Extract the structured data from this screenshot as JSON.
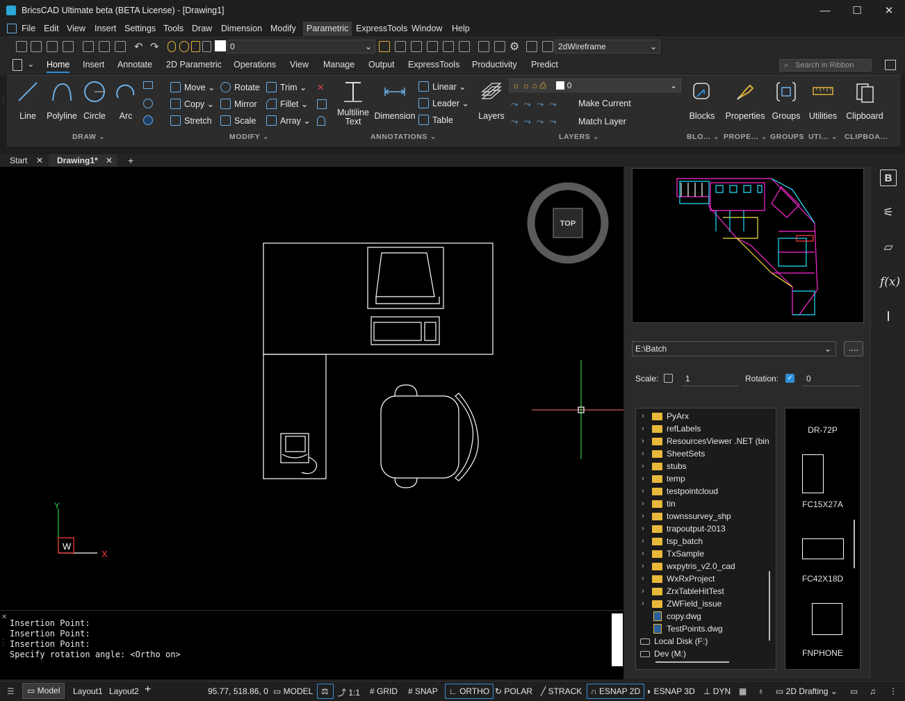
{
  "window": {
    "title": "BricsCAD Ultimate beta (BETA License) - [Drawing1]",
    "controls": [
      "minimize",
      "maximize",
      "close"
    ]
  },
  "menu": [
    "File",
    "Edit",
    "View",
    "Insert",
    "Settings",
    "Tools",
    "Draw",
    "Dimension",
    "Modify",
    "Parametric",
    "ExpressTools",
    "Window",
    "Help"
  ],
  "menu_active": "Parametric",
  "toolbar": {
    "layer_value": "0",
    "visual_style": "2dWireframe"
  },
  "ribbon_tabs": [
    "Home",
    "Insert",
    "Annotate",
    "2D Parametric",
    "Operations",
    "View",
    "Manage",
    "Output",
    "ExpressTools",
    "Productivity",
    "Predict"
  ],
  "ribbon_active": "Home",
  "ribbon_search_placeholder": "Search in Ribbon",
  "ribbon": {
    "draw": {
      "title": "DRAW",
      "line": "Line",
      "polyline": "Polyline",
      "circle": "Circle",
      "arc": "Arc"
    },
    "modify": {
      "title": "MODIFY",
      "move": "Move",
      "rotate": "Rotate",
      "trim": "Trim",
      "copy": "Copy",
      "mirror": "Mirror",
      "fillet": "Fillet",
      "stretch": "Stretch",
      "scale": "Scale",
      "array": "Array"
    },
    "annotations": {
      "title": "ANNOTATIONS",
      "mtext": "Multiline Text",
      "dimension": "Dimension",
      "linear": "Linear",
      "leader": "Leader",
      "table": "Table"
    },
    "layers": {
      "title": "LAYERS",
      "layers_btn": "Layers",
      "layer_value": "0",
      "make_current": "Make Current",
      "match_layer": "Match Layer"
    },
    "blocks": {
      "label": "Blocks",
      "title": "BLO..."
    },
    "properties": {
      "label": "Properties",
      "title": "PROPE..."
    },
    "groups": {
      "label": "Groups",
      "title": "GROUPS"
    },
    "utilities": {
      "label": "Utilities",
      "title": "UTI..."
    },
    "clipboard": {
      "label": "Clipboard",
      "title": "CLIPBOA..."
    }
  },
  "doc_tabs": [
    {
      "label": "Start"
    },
    {
      "label": "Drawing1*"
    }
  ],
  "canvas": {
    "viewcube_label": "TOP",
    "ucs_y": "Y",
    "ucs_x": "X",
    "ucs_w": "W"
  },
  "command_history": [
    "Insertion Point:",
    "Insertion Point:",
    "Insertion Point:",
    "Specify rotation angle: <Ortho on>"
  ],
  "status": {
    "layouts": [
      "Model",
      "Layout1",
      "Layout2"
    ],
    "coords": "95.77, 518.86, 0",
    "model": "MODEL",
    "scale": "1:1",
    "grid": "GRID",
    "snap": "SNAP",
    "ortho": "ORTHO",
    "polar": "POLAR",
    "strack": "STRACK",
    "esnap2d": "ESNAP 2D",
    "esnap3d": "ESNAP 3D",
    "dyn": "DYN",
    "workspace": "2D Drafting"
  },
  "blocks_panel": {
    "path": "E:\\Batch",
    "browse_label": "....",
    "scale_label": "Scale:",
    "scale_checked": false,
    "scale_value": "1",
    "rotation_label": "Rotation:",
    "rotation_checked": true,
    "rotation_value": "0",
    "folders": [
      {
        "name": "PyArx",
        "type": "folder"
      },
      {
        "name": "refLabels",
        "type": "folder"
      },
      {
        "name": "ResourcesViewer .NET (bin",
        "type": "folder"
      },
      {
        "name": "SheetSets",
        "type": "folder"
      },
      {
        "name": "stubs",
        "type": "folder"
      },
      {
        "name": "temp",
        "type": "folder"
      },
      {
        "name": "testpointcloud",
        "type": "folder"
      },
      {
        "name": "tin",
        "type": "folder"
      },
      {
        "name": "townssurvey_shp",
        "type": "folder"
      },
      {
        "name": "trapoutput-2013",
        "type": "folder"
      },
      {
        "name": "tsp_batch",
        "type": "folder"
      },
      {
        "name": "TxSample",
        "type": "folder"
      },
      {
        "name": "wxpytris_v2.0_cad",
        "type": "folder"
      },
      {
        "name": "WxRxProject",
        "type": "folder"
      },
      {
        "name": "ZrxTableHitTest",
        "type": "folder"
      },
      {
        "name": "ZWField_issue",
        "type": "folder"
      },
      {
        "name": "copy.dwg",
        "type": "file"
      },
      {
        "name": "TestPoints.dwg",
        "type": "file"
      },
      {
        "name": "Local Disk (F:)",
        "type": "drive"
      },
      {
        "name": "Dev (M:)",
        "type": "drive"
      }
    ],
    "blocks": [
      "DR-72P",
      "FC15X27A",
      "FC42X18D",
      "FNPHONE"
    ]
  },
  "colors": {
    "accent": "#2d8fd8",
    "canvas_bg": "#000000",
    "preview_magenta": "#ff2bd6",
    "preview_cyan": "#22e3ff",
    "preview_yellow": "#f5e23a"
  }
}
